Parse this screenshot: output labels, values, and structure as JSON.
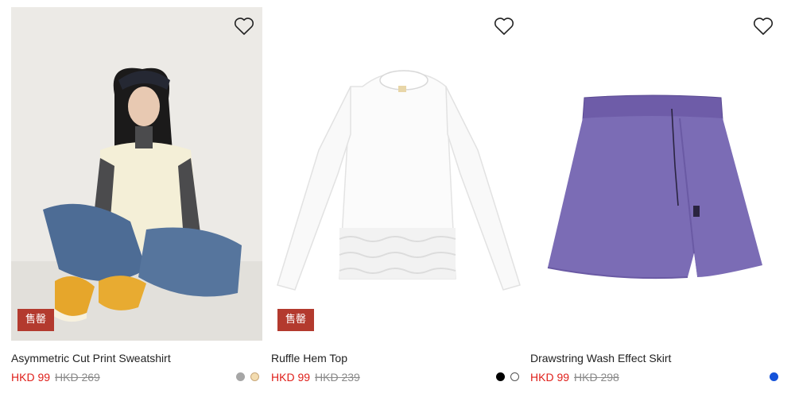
{
  "products": [
    {
      "title": "Asymmetric Cut Print Sweatshirt",
      "sale_price": "HKD 99",
      "original_price": "HKD 269",
      "badge": "售罄",
      "swatches": [
        {
          "color": "#a6a6a6"
        },
        {
          "color": "#f3dcb0"
        }
      ]
    },
    {
      "title": "Ruffle Hem Top",
      "sale_price": "HKD 99",
      "original_price": "HKD 239",
      "badge": "售罄",
      "swatches": [
        {
          "color": "#000000"
        },
        {
          "color": "#ffffff"
        }
      ]
    },
    {
      "title": "Drawstring Wash Effect Skirt",
      "sale_price": "HKD 99",
      "original_price": "HKD 298",
      "badge": "",
      "swatches": [
        {
          "color": "#1452d9"
        }
      ]
    }
  ],
  "icons": {
    "wishlist": "heart-outline-icon"
  },
  "colors": {
    "sale_price": "#e0201b",
    "original_price": "#8a8a8a",
    "badge_bg": "#b33a2e"
  }
}
